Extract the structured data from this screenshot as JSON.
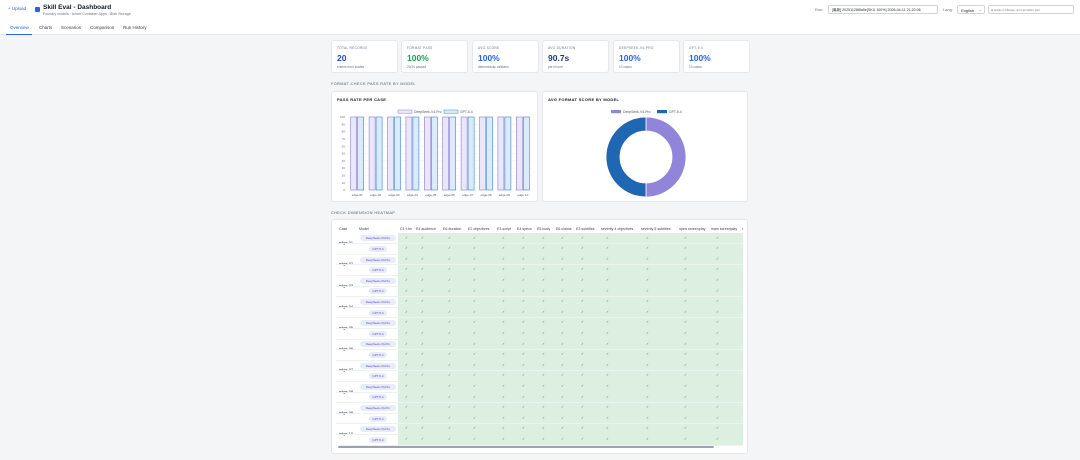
{
  "header": {
    "upload_label": "+ Upload",
    "title": "Skill Eval - Dashboard",
    "subtitle": "Foundry models · Azure Container Apps · Blob Storage",
    "run_label": "Run:",
    "run_value": "[最新] 20251128f8a5e[SKU 100%] 2026-04-11 21:20:06",
    "lang_label": "Lang:",
    "lang_value": "English",
    "notice": "⊞ results in Chinese, not in en before prior"
  },
  "tabs": [
    "Overview",
    "Charts",
    "Scenarios",
    "Comparison",
    "Run History"
  ],
  "active_tab": "Overview",
  "stats": [
    {
      "label": "TOTAL RECORDS",
      "value": "20",
      "sub": "entries from loaded",
      "color": "#1d4ed8"
    },
    {
      "label": "FORMAT PASS",
      "value": "100%",
      "sub": "20/20 passed",
      "color": "#16a34a"
    },
    {
      "label": "AVG SCORE",
      "value": "100%",
      "sub": "deterministic validator",
      "color": "#2563eb"
    },
    {
      "label": "AVG DURATION",
      "value": "90.7s",
      "sub": "per record",
      "color": "#1e3a8a"
    },
    {
      "label": "DEEPSEEK-V4-PRO",
      "value": "100%",
      "sub": "10 cases",
      "color": "#2563eb"
    },
    {
      "label": "GPT-5.4",
      "value": "100%",
      "sub": "10 cases",
      "color": "#2563eb"
    }
  ],
  "sections": {
    "pass_rate_section": "FORMAT-CHECK PASS RATE BY MODEL",
    "heatmap_section": "CHECK DIMENSION HEATMAP"
  },
  "chart_data": [
    {
      "type": "bar",
      "title": "PASS RATE PER CASE",
      "categories": [
        "edge-01",
        "edge-02",
        "edge-03",
        "edge-04",
        "edge-05",
        "edge-06",
        "edge-07",
        "edge-08",
        "edge-09",
        "edge-10"
      ],
      "series": [
        {
          "name": "DeepSeek-V4-Pro",
          "values": [
            100,
            100,
            100,
            100,
            100,
            100,
            100,
            100,
            100,
            100
          ],
          "fill": "#ebe7fb",
          "stroke": "#8b7cd8"
        },
        {
          "name": "GPT-5.4",
          "values": [
            100,
            100,
            100,
            100,
            100,
            100,
            100,
            100,
            100,
            100
          ],
          "fill": "#dcebfb",
          "stroke": "#3a86d6"
        }
      ],
      "yticks": [
        0,
        10,
        20,
        30,
        40,
        50,
        60,
        70,
        80,
        90,
        100
      ],
      "ylim": [
        0,
        100
      ],
      "legend": "top"
    },
    {
      "type": "pie",
      "title": "AVG FORMAT SCORE BY MODEL",
      "donut": true,
      "slices": [
        {
          "name": "DeepSeek-V4-Pro",
          "value": 100,
          "color": "#9184db"
        },
        {
          "name": "GPT-5.4",
          "value": 100,
          "color": "#1f66b3"
        }
      ],
      "legend": "top"
    }
  ],
  "heatmap": {
    "columns": [
      "Case",
      "Model",
      "C1 f-fm",
      "E4 audience",
      "E6 duration",
      "E2 objectives",
      "E3 script",
      "E4 specs",
      "E5 body",
      "E6 claims",
      "E3 subtitles",
      "severity 4 objectives",
      "severity 5 subtitles",
      "open screenplay",
      "main screenplay",
      "r"
    ],
    "cases": [
      "edge-01",
      "edge-02",
      "edge-03",
      "edge-04",
      "edge-05",
      "edge-06",
      "edge-07",
      "edge-08",
      "edge-09",
      "edge-10"
    ],
    "models": [
      "DeepSeek-V4-Pro",
      "GPT-5.4"
    ],
    "cell": "✓"
  }
}
